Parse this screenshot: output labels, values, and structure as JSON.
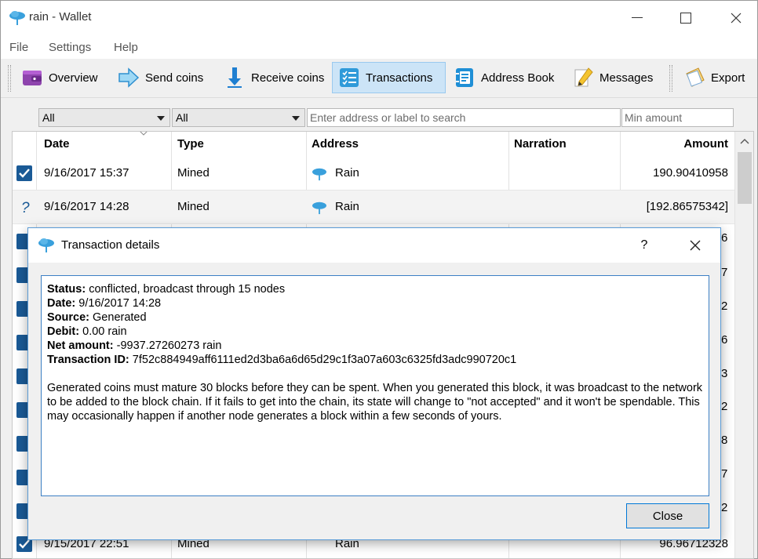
{
  "window": {
    "title": "rain - Wallet"
  },
  "menu": [
    "File",
    "Settings",
    "Help"
  ],
  "toolbar": {
    "overview": "Overview",
    "send": "Send coins",
    "receive": "Receive coins",
    "transactions": "Transactions",
    "addressbook": "Address Book",
    "messages": "Messages",
    "export": "Export"
  },
  "filters": {
    "date_combo": "All",
    "type_combo": "All",
    "search_placeholder": "Enter address or label to search",
    "min_amount_placeholder": "Min amount"
  },
  "table": {
    "headers": {
      "date": "Date",
      "type": "Type",
      "address": "Address",
      "narration": "Narration",
      "amount": "Amount"
    },
    "rows": [
      {
        "status": "confirmed-check",
        "date": "9/16/2017 15:37",
        "type": "Mined",
        "address": "Rain",
        "narration": "",
        "amount": "190.90410958"
      },
      {
        "status": "unknown-question",
        "date": "9/16/2017 14:28",
        "type": "Mined",
        "address": "Rain",
        "narration": "",
        "amount": "[192.86575342]"
      }
    ],
    "partial_bottom_row": {
      "date": "9/15/2017 22:51",
      "type": "Mined",
      "address": "Rain",
      "amount": "96.96712328"
    },
    "cut_digits": [
      "6",
      "7",
      "2",
      "6",
      "3",
      "2",
      "8",
      "7",
      "2"
    ]
  },
  "dialog": {
    "title": "Transaction details",
    "help": "?",
    "status_label": "Status:",
    "status_value": "conflicted, broadcast through 15 nodes",
    "date_label": "Date:",
    "date_value": "9/16/2017 14:28",
    "source_label": "Source:",
    "source_value": "Generated",
    "debit_label": "Debit:",
    "debit_value": "0.00 rain",
    "net_label": "Net amount:",
    "net_value": "-9937.27260273 rain",
    "txid_label": "Transaction ID:",
    "txid_value": "7f52c884949aff6111ed2d3ba6a6d65d29c1f3a07a603c6325fd3adc990720c1",
    "note": "Generated coins must mature 30 blocks before they can be spent. When you generated this block, it was broadcast to the network to be added to the block chain. If it fails to get into the chain, its state will change to \"not accepted\" and it won't be spendable. This may occasionally happen if another node generates a block within a few seconds of yours.",
    "close_button": "Close"
  },
  "colors": {
    "accent": "#0078d7",
    "check": "#1a5a96",
    "cloud": "#2f9ad9"
  }
}
